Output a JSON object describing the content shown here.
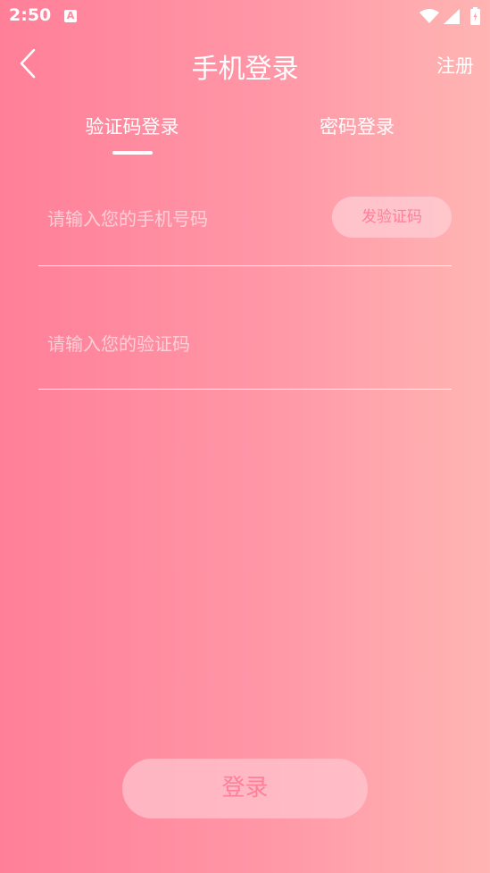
{
  "status_bar": {
    "time": "2:50",
    "notification_badge": "A",
    "icons": [
      "wifi-icon",
      "signal-icon",
      "battery-icon"
    ]
  },
  "header": {
    "back_icon": "chevron-left-icon",
    "title": "手机登录",
    "register_label": "注册"
  },
  "tabs": [
    {
      "label": "验证码登录",
      "active": true
    },
    {
      "label": "密码登录",
      "active": false
    }
  ],
  "form": {
    "phone_placeholder": "请输入您的手机号码",
    "phone_value": "",
    "send_code_label": "发验证码",
    "code_placeholder": "请输入您的验证码",
    "code_value": ""
  },
  "login_label": "登录",
  "colors": {
    "gradient_start": "#ff7f98",
    "gradient_end": "#ffb5b3",
    "button_text": "#ff7f98"
  }
}
